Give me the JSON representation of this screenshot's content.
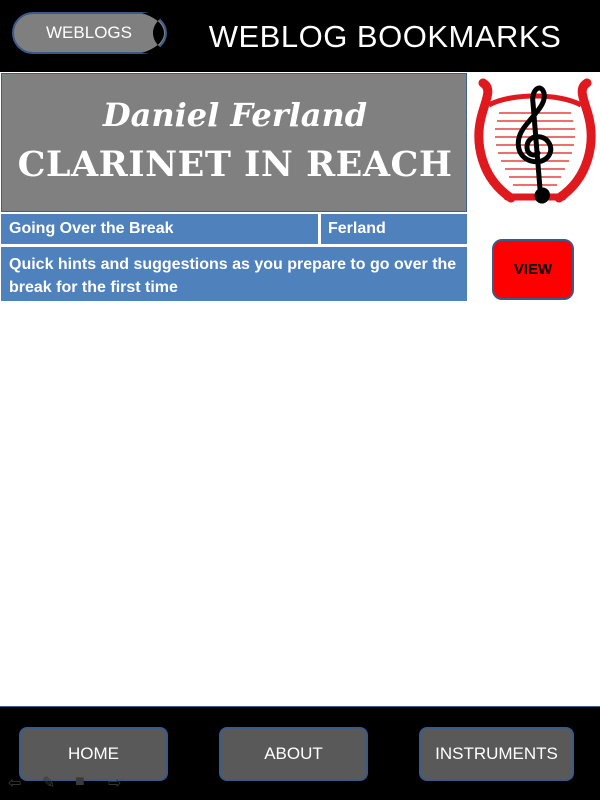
{
  "header": {
    "weblogs_button": "WEBLOGS",
    "title": "WEBLOG BOOKMARKS"
  },
  "banner": {
    "author_script": "Daniel Ferland",
    "blog_name": "CLARINET IN REACH"
  },
  "logo": {
    "icon": "lyre-treble-clef-icon"
  },
  "entry": {
    "post_title": "Going Over the Break",
    "author": "Ferland",
    "description": "Quick hints and suggestions as you prepare to go over the break for the first time",
    "view_button": "VIEW"
  },
  "footer": {
    "nav": [
      "HOME",
      "ABOUT",
      "INSTRUMENTS"
    ],
    "toolbar_icons": [
      "back-arrow-icon",
      "pen-icon",
      "slide-icon",
      "forward-arrow-icon"
    ]
  },
  "colors": {
    "header_bg": "#000000",
    "banner_bg": "#808080",
    "row_bg": "#4f81bd",
    "view_button": "#ff0000",
    "nav_button": "#595959",
    "logo_red": "#e0191e"
  }
}
